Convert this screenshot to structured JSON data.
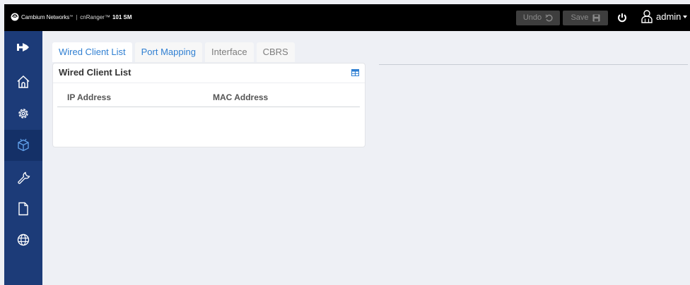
{
  "header": {
    "brand_name": "Cambium Networks",
    "brand_tm": "™",
    "brand_sep": "|",
    "product": "cnRanger™",
    "model": "101 SM",
    "undo_label": "Undo",
    "save_label": "Save",
    "user_name": "admin"
  },
  "sidebar": {
    "items": [
      {
        "icon": "pin-icon"
      },
      {
        "icon": "home-icon"
      },
      {
        "icon": "gear-icon"
      },
      {
        "icon": "box-network-icon",
        "active": true
      },
      {
        "icon": "wrench-icon"
      },
      {
        "icon": "file-icon"
      },
      {
        "icon": "globe-icon"
      }
    ]
  },
  "tabs": [
    {
      "label": "Wired Client List",
      "state": "active"
    },
    {
      "label": "Port Mapping",
      "state": "link"
    },
    {
      "label": "Interface",
      "state": "muted"
    },
    {
      "label": "CBRS",
      "state": "muted"
    }
  ],
  "panel": {
    "title": "Wired Client List",
    "columns": [
      "IP Address",
      "MAC Address"
    ]
  },
  "colors": {
    "topbar": "#000000",
    "sidebar": "#1c3b78",
    "sidebar_active": "#143067",
    "accent": "#2f7fd2",
    "background": "#eef0f5"
  }
}
